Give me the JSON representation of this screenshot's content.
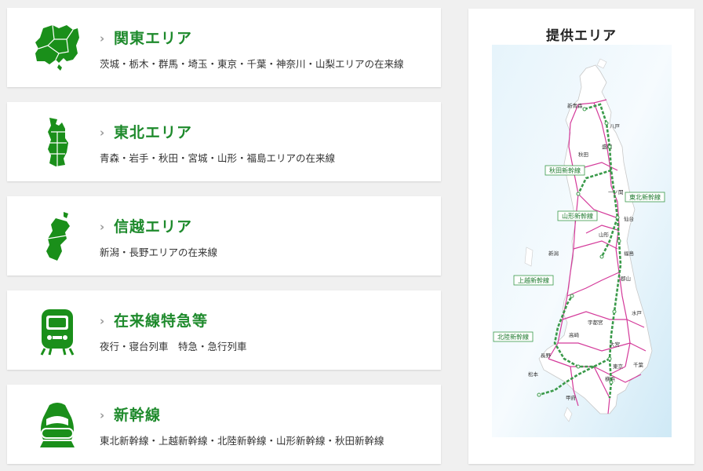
{
  "areas": [
    {
      "title": "関東エリア",
      "desc": "茨城・栃木・群馬・埼玉・東京・千葉・神奈川・山梨エリアの在来線",
      "icon": "kanto-map-icon"
    },
    {
      "title": "東北エリア",
      "desc": "青森・岩手・秋田・宮城・山形・福島エリアの在来線",
      "icon": "tohoku-map-icon"
    },
    {
      "title": "信越エリア",
      "desc": "新潟・長野エリアの在来線",
      "icon": "shinetsu-map-icon"
    },
    {
      "title": "在来線特急等",
      "desc": "夜行・寝台列車　特急・急行列車",
      "icon": "limited-express-train-icon"
    },
    {
      "title": "新幹線",
      "desc": "東北新幹線・上越新幹線・北陸新幹線・山形新幹線・秋田新幹線",
      "icon": "shinkansen-icon"
    }
  ],
  "chevron": "›",
  "map": {
    "title": "提供エリア",
    "line_labels": {
      "akita": "秋田新幹線",
      "tohoku": "東北新幹線",
      "yamagata": "山形新幹線",
      "joetsu": "上越新幹線",
      "hokuriku": "北陸新幹線"
    },
    "stations": {
      "aomori": "新青森",
      "hachinohe": "八戸",
      "morioka": "盛岡",
      "akita": "秋田",
      "sendai": "仙台",
      "yamagata": "山形",
      "fukushima": "福島",
      "niigata": "新潟",
      "koriyama": "郡山",
      "utsunomiya": "宇都宮",
      "takasaki": "高崎",
      "omiya": "大宮",
      "tokyo": "東京",
      "yokohama": "横浜",
      "nagano": "長野",
      "matsumoto": "松本",
      "kofu": "甲府",
      "mito": "水戸",
      "chiba": "千葉",
      "ichinoseki": "一ノ関"
    }
  },
  "colors": {
    "accent": "#1e8a2c",
    "icon": "#1a8f1a",
    "rail": "#d43a9a",
    "shinkansen": "#3a9a4a",
    "land": "#ffffff",
    "sea": "#cfe9f6"
  }
}
